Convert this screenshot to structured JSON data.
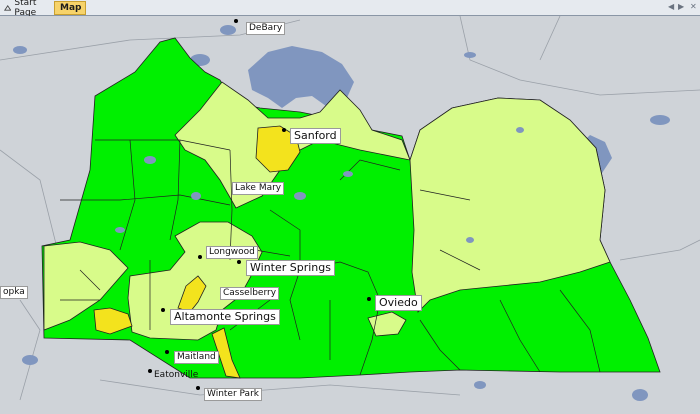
{
  "tabs": [
    {
      "label": "Start Page",
      "active": false,
      "icon": "start-page-icon"
    },
    {
      "label": "Map",
      "active": true,
      "icon": "map-icon"
    }
  ],
  "tab_controls": {
    "left": "◀",
    "right": "▶",
    "close": "✕"
  },
  "colors": {
    "background": "#cfd3d8",
    "water": "#8096bf",
    "green": "#00f000",
    "light_green": "#d8fb8a",
    "yellow": "#f3e31d",
    "boundary": "#202020"
  },
  "cities": {
    "debary": "DeBary",
    "sanford": "Sanford",
    "lake_mary": "Lake Mary",
    "longwood": "Longwood",
    "winter_springs": "Winter Springs",
    "casselberry": "Casselberry",
    "altamonte_springs": "Altamonte Springs",
    "oviedo": "Oviedo",
    "maitland": "Maitland",
    "eatonville": "Eatonville",
    "winter_park": "Winter Park",
    "apopka_partial": "opka"
  }
}
